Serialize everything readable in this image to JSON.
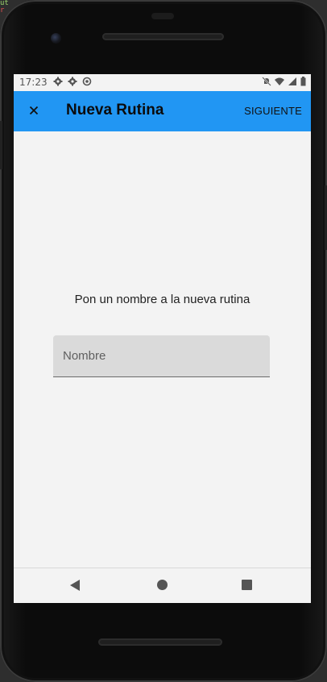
{
  "status_bar": {
    "time": "17:23",
    "left_icons": [
      "gear-icon",
      "gear-icon",
      "sync-icon"
    ],
    "right_icons": [
      "notifications-off-icon",
      "wifi-icon",
      "signal-icon",
      "battery-icon"
    ]
  },
  "app_bar": {
    "title": "Nueva Rutina",
    "close_icon": "close-icon",
    "next_label": "SIGUIENTE",
    "color": "#2196f3"
  },
  "main": {
    "prompt": "Pon un nombre a la nueva rutina",
    "name_field": {
      "placeholder": "Nombre",
      "value": ""
    }
  },
  "nav_bar": {
    "buttons": [
      "back-icon",
      "home-icon",
      "recents-icon"
    ]
  }
}
